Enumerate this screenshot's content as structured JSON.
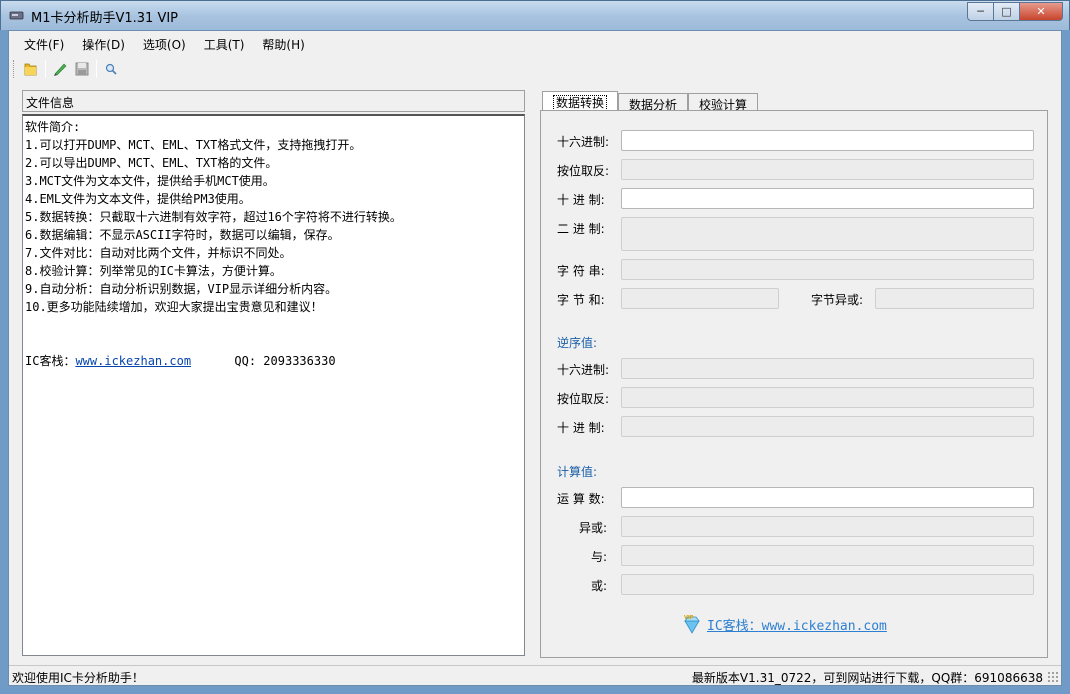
{
  "window": {
    "title": "M1卡分析助手V1.31 VIP",
    "controls": {
      "minimize": "─",
      "maximize": "□",
      "close": "✕"
    }
  },
  "menu": [
    "文件(F)",
    "操作(D)",
    "选项(O)",
    "工具(T)",
    "帮助(H)"
  ],
  "toolbar": {
    "icons": [
      "folder-open-icon",
      "pen-icon",
      "save-icon",
      "magnifier-icon"
    ]
  },
  "left": {
    "header": "文件信息",
    "lines": [
      "软件简介:",
      "1.可以打开DUMP、MCT、EML、TXT格式文件，支持拖拽打开。",
      "2.可以导出DUMP、MCT、EML、TXT格的文件。",
      "3.MCT文件为文本文件，提供给手机MCT使用。",
      "4.EML文件为文本文件，提供给PM3使用。",
      "5.数据转换：只截取十六进制有效字符，超过16个字符将不进行转换。",
      "6.数据编辑：不显示ASCII字符时，数据可以编辑，保存。",
      "7.文件对比：自动对比两个文件，并标识不同处。",
      "8.校验计算：列举常见的IC卡算法，方便计算。",
      "9.自动分析：自动分析识别数据，VIP显示详细分析内容。",
      "10.更多功能陆续增加，欢迎大家提出宝贵意见和建议！"
    ],
    "footer_label": "IC客栈：",
    "footer_link": "www.ickezhan.com",
    "footer_qq": "QQ: 2093336330"
  },
  "tabs": [
    "数据转换",
    "数据分析",
    "校验计算"
  ],
  "conversion": {
    "hex_label": "十六进制:",
    "invert_label": "按位取反:",
    "dec_label": "十  进  制:",
    "bin_label": "二  进  制:",
    "str_label": "字  符  串:",
    "bytesum_label": "字  节  和:",
    "bytexor_label": "字节异或:",
    "reverse_section": "逆序值:",
    "rev_hex_label": "十六进制:",
    "rev_invert_label": "按位取反:",
    "rev_dec_label": "十  进  制:",
    "calc_section": "计算值:",
    "operand_label": "运  算  数:",
    "xor_label": "异或:",
    "and_label": "与:",
    "or_label": "或:"
  },
  "brand": {
    "badge": "VIP",
    "text": "IC客栈：www.ickezhan.com"
  },
  "status": {
    "left": "欢迎使用IC卡分析助手！",
    "right": "最新版本V1.31_0722，可到网站进行下载，QQ群：691086638"
  }
}
